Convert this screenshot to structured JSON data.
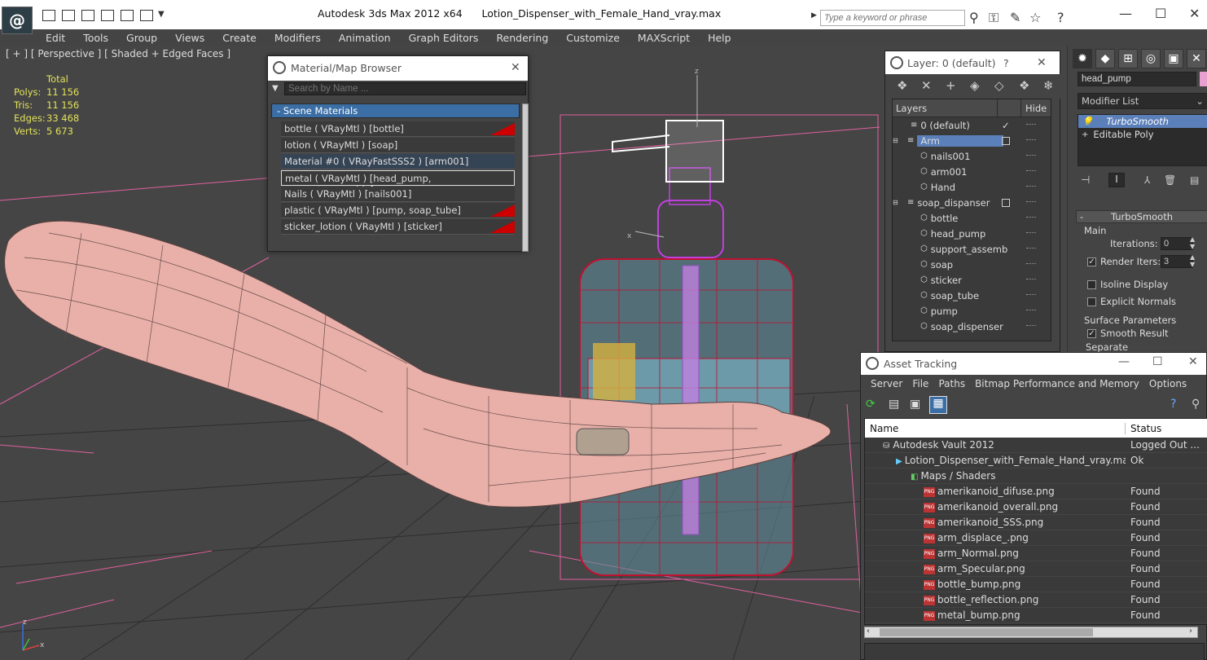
{
  "titlebar": {
    "app_title": "Autodesk 3ds Max  2012 x64",
    "file_title": "Lotion_Dispenser_with_Female_Hand_vray.max",
    "search_placeholder": "Type a keyword or phrase"
  },
  "menus": [
    "Edit",
    "Tools",
    "Group",
    "Views",
    "Create",
    "Modifiers",
    "Animation",
    "Graph Editors",
    "Rendering",
    "Customize",
    "MAXScript",
    "Help"
  ],
  "viewport": {
    "label": "[ + ] [ Perspective ] [ Shaded + Edged Faces ]",
    "stats_header": "Total",
    "stats": [
      {
        "k": "Polys:",
        "v": "11 156"
      },
      {
        "k": "Tris:",
        "v": "11 156"
      },
      {
        "k": "Edges:",
        "v": "33 468"
      },
      {
        "k": "Verts:",
        "v": "5 673"
      }
    ],
    "axis_z": "z",
    "axis_x": "x",
    "gizmo_z": "z",
    "gizmo_x": "x"
  },
  "material_browser": {
    "title": "Material/Map Browser",
    "search_placeholder": "Search by Name ...",
    "group": "- Scene Materials",
    "items": [
      {
        "label": "bottle  ( VRayMtl )  [bottle]",
        "red": true
      },
      {
        "label": "lotion  ( VRayMtl )  [soap]",
        "red": false
      },
      {
        "label": "Material #0  ( VRayFastSSS2 )  [arm001]",
        "red": false
      },
      {
        "label": "metal  ( VRayMtl )  [head_pump, support_assembly]",
        "red": false,
        "selected": true
      },
      {
        "label": "Nails  ( VRayMtl )  [nails001]",
        "red": false
      },
      {
        "label": "plastic  ( VRayMtl )  [pump, soap_tube]",
        "red": true
      },
      {
        "label": "sticker_lotion  ( VRayMtl )  [sticker]",
        "red": true
      }
    ]
  },
  "layer_panel": {
    "title": "Layer: 0 (default)",
    "help": "?",
    "col_layers": "Layers",
    "col_hide": "Hide",
    "rows": [
      {
        "label": "0 (default)",
        "indent": 0,
        "check": "✓"
      },
      {
        "label": "Arm",
        "indent": 0,
        "selected": true
      },
      {
        "label": "nails001",
        "indent": 1
      },
      {
        "label": "arm001",
        "indent": 1
      },
      {
        "label": "Hand",
        "indent": 1
      },
      {
        "label": "soap_dispanser",
        "indent": 0
      },
      {
        "label": "bottle",
        "indent": 1
      },
      {
        "label": "head_pump",
        "indent": 1
      },
      {
        "label": "support_assemb",
        "indent": 1
      },
      {
        "label": "soap",
        "indent": 1
      },
      {
        "label": "sticker",
        "indent": 1
      },
      {
        "label": "soap_tube",
        "indent": 1
      },
      {
        "label": "pump",
        "indent": 1
      },
      {
        "label": "soap_dispenser",
        "indent": 1
      }
    ]
  },
  "command_panel": {
    "object_name": "head_pump",
    "modifier_list": "Modifier List",
    "stack": [
      "TurboSmooth",
      "Editable Poly"
    ],
    "rollout_title": "TurboSmooth",
    "main_label": "Main",
    "iterations_label": "Iterations:",
    "iterations_value": "0",
    "render_iters_label": "Render Iters:",
    "render_iters_value": "3",
    "isoline_label": "Isoline Display",
    "explicit_label": "Explicit Normals",
    "surface_label": "Surface Parameters",
    "smooth_result_label": "Smooth Result",
    "separate_label": "Separate"
  },
  "asset_tracking": {
    "title": "Asset Tracking",
    "menus": [
      "Server",
      "File",
      "Paths",
      "Bitmap Performance and Memory",
      "Options"
    ],
    "col_name": "Name",
    "col_status": "Status",
    "rows": [
      {
        "name": "Autodesk Vault 2012",
        "status": "Logged Out ...",
        "indent": 1,
        "icon": "vault"
      },
      {
        "name": "Lotion_Dispenser_with_Female_Hand_vray.max",
        "status": "Ok",
        "indent": 2,
        "icon": "max"
      },
      {
        "name": "Maps / Shaders",
        "status": "",
        "indent": 3,
        "icon": "maps"
      },
      {
        "name": "amerikanoid_difuse.png",
        "status": "Found",
        "indent": 4,
        "icon": "png"
      },
      {
        "name": "amerikanoid_overall.png",
        "status": "Found",
        "indent": 4,
        "icon": "png"
      },
      {
        "name": "amerikanoid_SSS.png",
        "status": "Found",
        "indent": 4,
        "icon": "png"
      },
      {
        "name": "arm_displace_.png",
        "status": "Found",
        "indent": 4,
        "icon": "png"
      },
      {
        "name": "arm_Normal.png",
        "status": "Found",
        "indent": 4,
        "icon": "png"
      },
      {
        "name": "arm_Specular.png",
        "status": "Found",
        "indent": 4,
        "icon": "png"
      },
      {
        "name": "bottle_bump.png",
        "status": "Found",
        "indent": 4,
        "icon": "png"
      },
      {
        "name": "bottle_reflection.png",
        "status": "Found",
        "indent": 4,
        "icon": "png"
      },
      {
        "name": "metal_bump.png",
        "status": "Found",
        "indent": 4,
        "icon": "png"
      }
    ]
  },
  "colors": {
    "accent": "#5b7fb8",
    "material_red": "#cc0000",
    "stats_yellow": "#e2e25a",
    "skin": "#e8b0a8"
  }
}
